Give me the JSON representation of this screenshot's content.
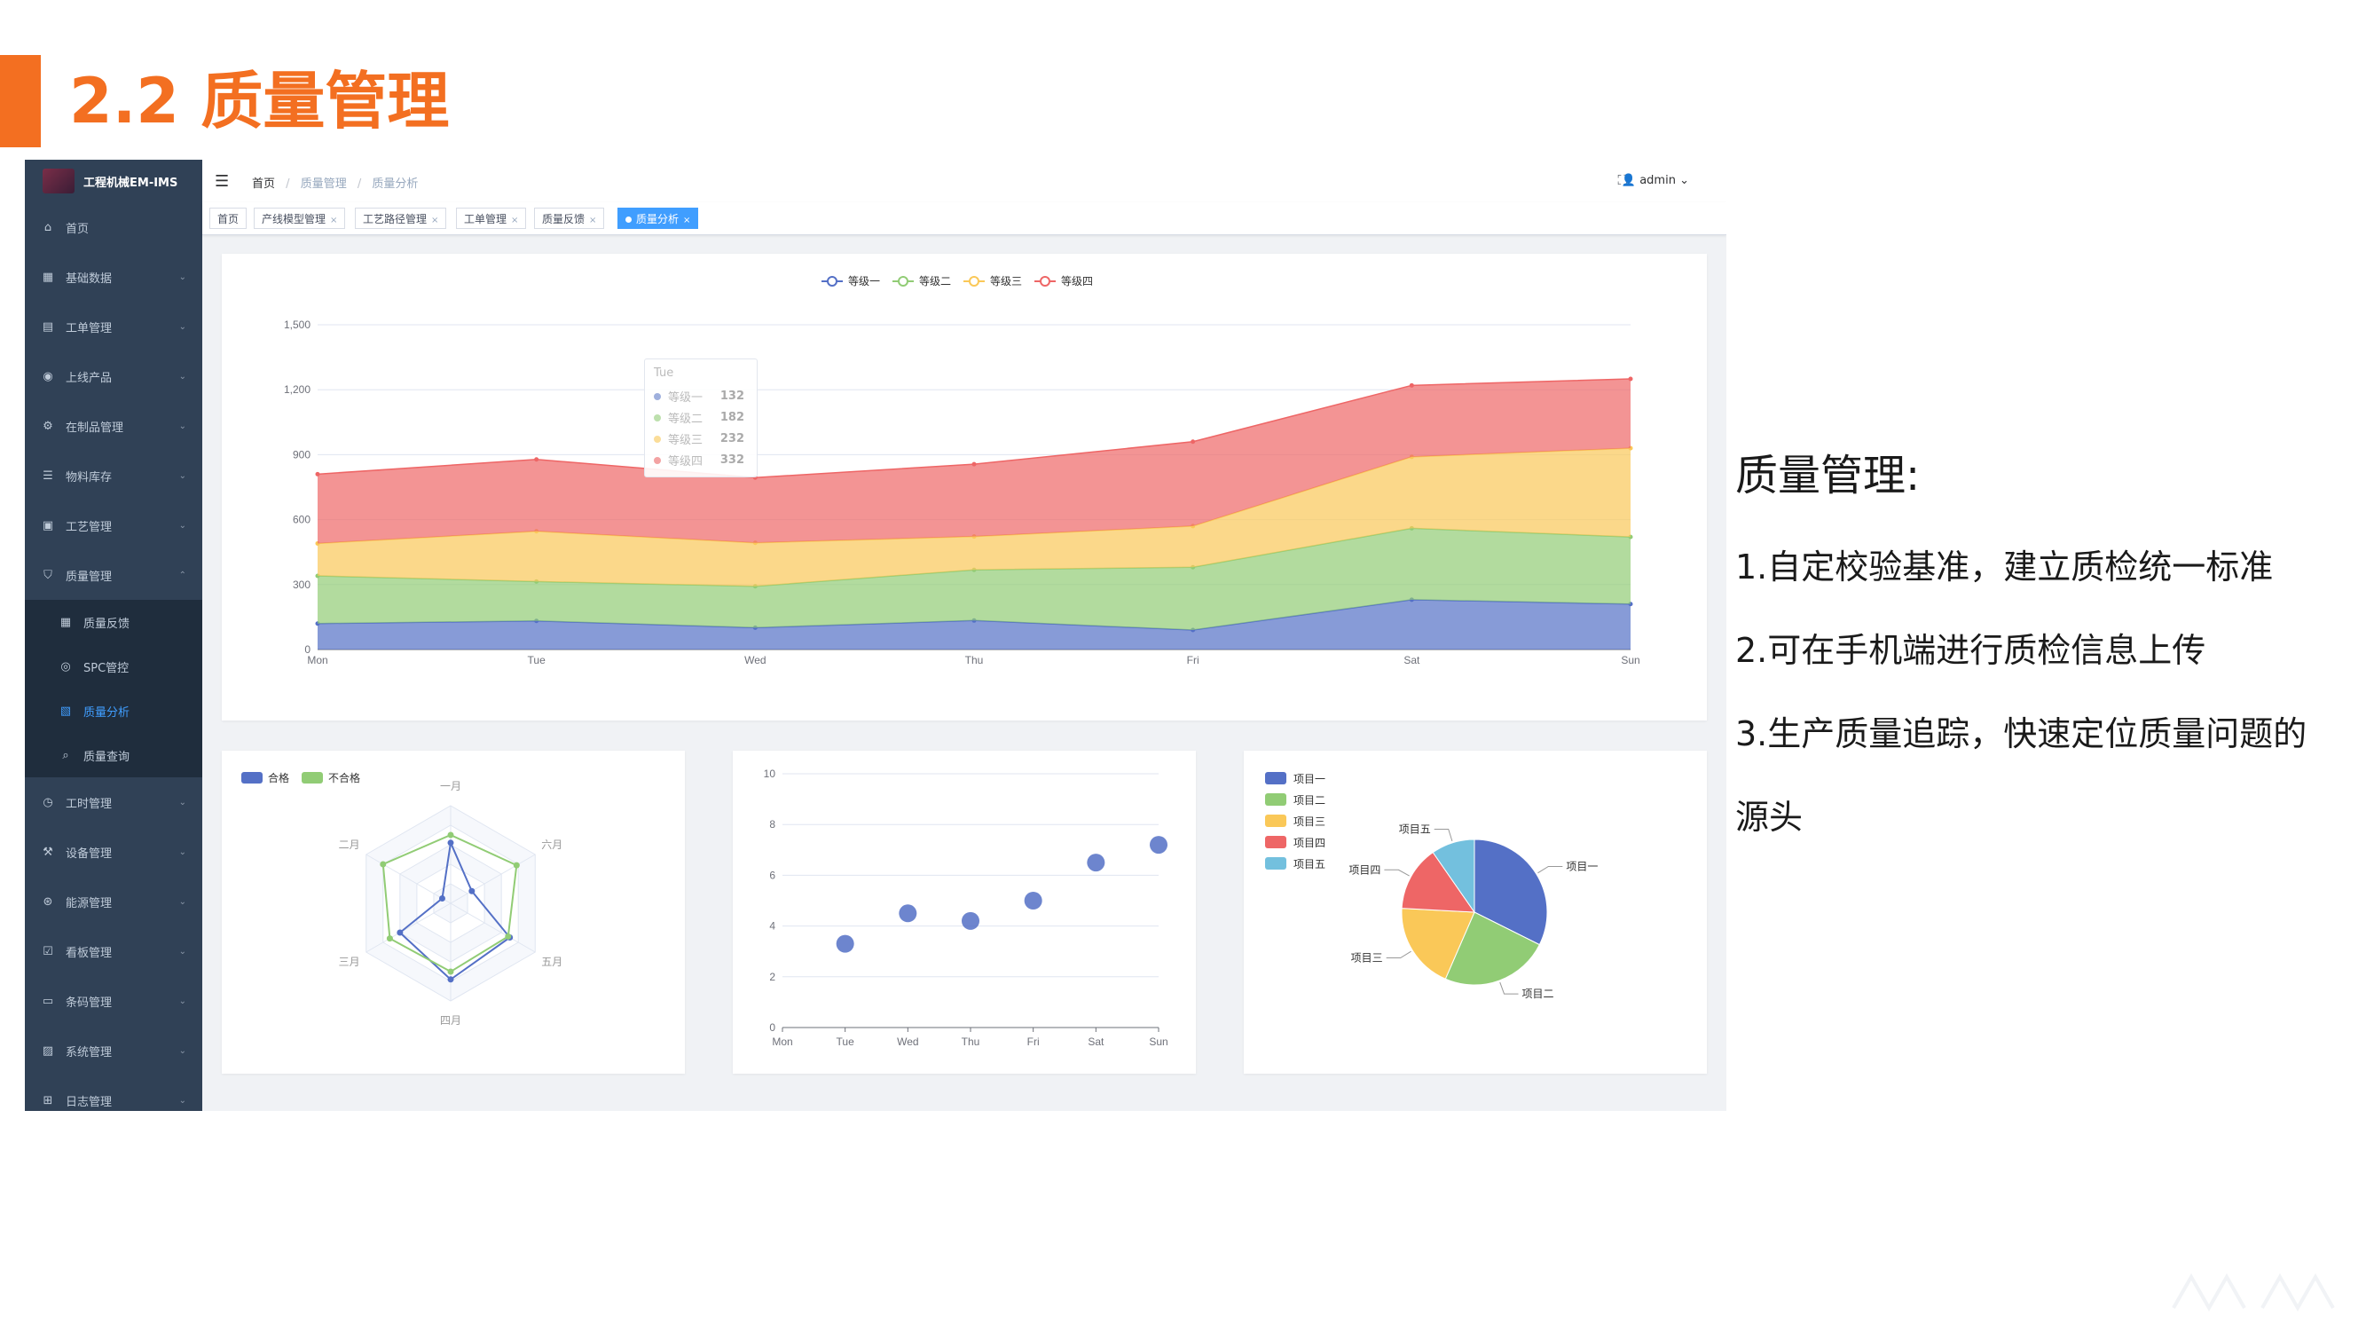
{
  "slide": {
    "title": "2.2 质量管理",
    "accent_color": "#f36f21"
  },
  "app": {
    "logo_text": "工程机械EM-IMS",
    "sidebar": {
      "items": [
        {
          "label": "首页",
          "icon": "home-icon"
        },
        {
          "label": "基础数据",
          "icon": "grid-icon"
        },
        {
          "label": "工单管理",
          "icon": "document-icon"
        },
        {
          "label": "上线产品",
          "icon": "product-icon"
        },
        {
          "label": "在制品管理",
          "icon": "gears-icon"
        },
        {
          "label": "物料库存",
          "icon": "stack-icon"
        },
        {
          "label": "工艺管理",
          "icon": "calendar-icon"
        },
        {
          "label": "质量管理",
          "icon": "shield-icon",
          "expanded": true
        }
      ],
      "sub_items": [
        {
          "label": "质量反馈",
          "icon": "table-icon"
        },
        {
          "label": "SPC管控",
          "icon": "globe-icon"
        },
        {
          "label": "质量分析",
          "icon": "report-icon",
          "active": true
        },
        {
          "label": "质量查询",
          "icon": "search-icon"
        }
      ],
      "items_after": [
        {
          "label": "工时管理",
          "icon": "timer-icon"
        },
        {
          "label": "设备管理",
          "icon": "machine-icon"
        },
        {
          "label": "能源管理",
          "icon": "energy-icon"
        },
        {
          "label": "看板管理",
          "icon": "board-icon"
        },
        {
          "label": "条码管理",
          "icon": "barcode-icon"
        },
        {
          "label": "系统管理",
          "icon": "settings-icon"
        },
        {
          "label": "日志管理",
          "icon": "log-icon"
        }
      ]
    },
    "breadcrumb": [
      "首页",
      "质量管理",
      "质量分析"
    ],
    "user": "admin",
    "tags": [
      {
        "label": "首页"
      },
      {
        "label": "产线模型管理"
      },
      {
        "label": "工艺路径管理"
      },
      {
        "label": "工单管理"
      },
      {
        "label": "质量反馈"
      },
      {
        "label": "质量分析",
        "active": true
      }
    ],
    "tooltip": {
      "title": "Tue",
      "rows": [
        {
          "name": "等级一",
          "value": "132"
        },
        {
          "name": "等级二",
          "value": "182"
        },
        {
          "name": "等级三",
          "value": "232"
        },
        {
          "name": "等级四",
          "value": "332"
        }
      ]
    }
  },
  "chart_data": [
    {
      "type": "area",
      "stacked": true,
      "categories": [
        "Mon",
        "Tue",
        "Wed",
        "Thu",
        "Fri",
        "Sat",
        "Sun"
      ],
      "ylim": [
        0,
        1500
      ],
      "yticks": [
        "0",
        "300",
        "600",
        "900",
        "1,200",
        "1,500"
      ],
      "legend_position": "top-center",
      "grid": true,
      "series": [
        {
          "name": "等级一",
          "color": "#5470c6",
          "values": [
            120,
            132,
            101,
            134,
            90,
            230,
            210
          ]
        },
        {
          "name": "等级二",
          "color": "#91cc75",
          "values": [
            220,
            182,
            191,
            234,
            290,
            330,
            310
          ]
        },
        {
          "name": "等级三",
          "color": "#fac858",
          "values": [
            150,
            232,
            201,
            154,
            190,
            330,
            410
          ]
        },
        {
          "name": "等级四",
          "color": "#ee6666",
          "values": [
            320,
            332,
            301,
            334,
            390,
            330,
            320
          ]
        }
      ]
    },
    {
      "type": "radar",
      "indicators": [
        "一月",
        "六月",
        "五月",
        "四月",
        "三月",
        "二月"
      ],
      "max": 100,
      "legend_position": "top-left",
      "series": [
        {
          "name": "合格",
          "color": "#5470c6",
          "values": [
            62,
            25,
            70,
            78,
            60,
            10
          ]
        },
        {
          "name": "不合格",
          "color": "#91cc75",
          "values": [
            70,
            78,
            68,
            70,
            72,
            80
          ]
        }
      ]
    },
    {
      "type": "scatter",
      "categories": [
        "Mon",
        "Tue",
        "Wed",
        "Thu",
        "Fri",
        "Sat",
        "Sun"
      ],
      "ylim": [
        0,
        10
      ],
      "yticks": [
        "0",
        "2",
        "4",
        "6",
        "8",
        "10"
      ],
      "color": "#5470c6",
      "values": [
        null,
        3.3,
        4.5,
        4.2,
        5.0,
        6.5,
        7.2
      ]
    },
    {
      "type": "pie",
      "legend_position": "left",
      "slices": [
        {
          "name": "项目一",
          "value": 335,
          "color": "#5470c6"
        },
        {
          "name": "项目二",
          "value": 250,
          "color": "#91cc75"
        },
        {
          "name": "项目三",
          "value": 200,
          "color": "#fac858"
        },
        {
          "name": "项目四",
          "value": 150,
          "color": "#ee6666"
        },
        {
          "name": "项目五",
          "value": 100,
          "color": "#73c0de"
        }
      ]
    }
  ],
  "panel": {
    "heading": "质量管理:",
    "lines": [
      "1.自定校验基准，建立质检统一标准",
      "2.可在手机端进行质检信息上传",
      "3.生产质量追踪，快速定位质量问题的",
      "源头"
    ]
  }
}
